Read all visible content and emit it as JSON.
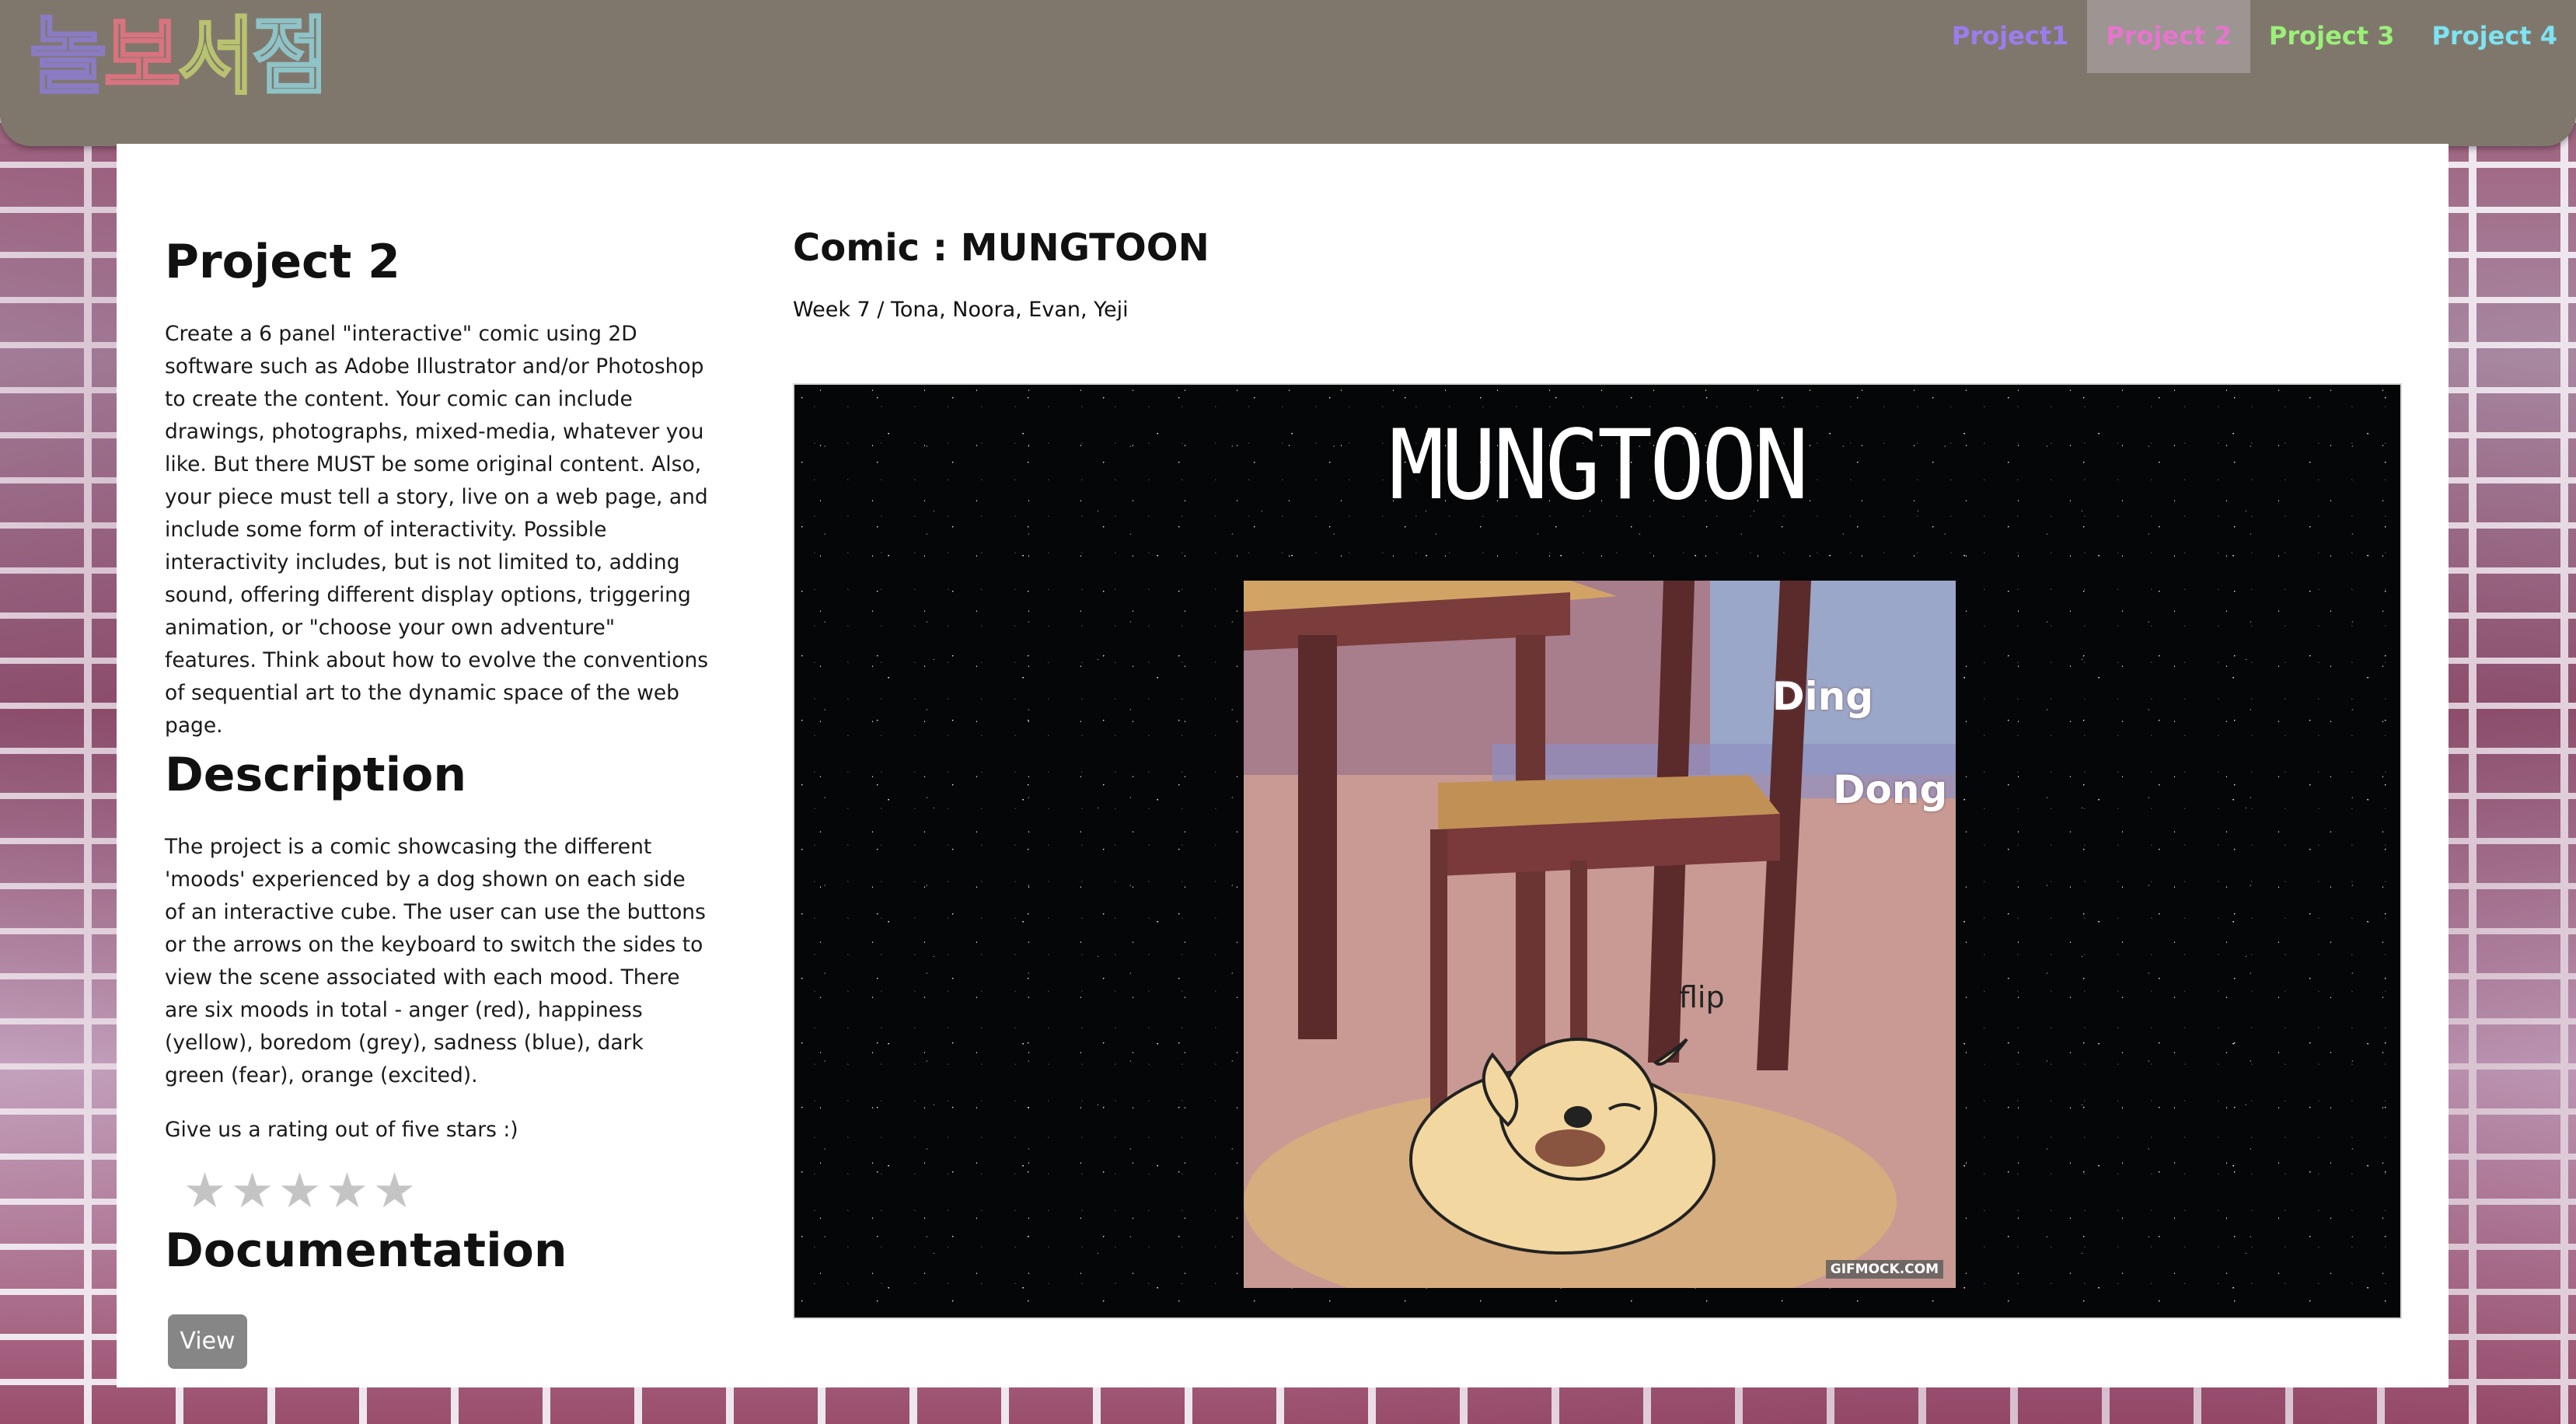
{
  "header": {
    "logo_text": "놀보서점",
    "logo_colors": [
      "#8a7bc4",
      "#d9737f",
      "#b8c270",
      "#8ec3c7"
    ],
    "nav": [
      {
        "label": "Project1",
        "color": "#9b7df0",
        "active": false
      },
      {
        "label": "Project 2",
        "color": "#e774cf",
        "active": true
      },
      {
        "label": "Project 3",
        "color": "#9bf079",
        "active": false
      },
      {
        "label": "Project 4",
        "color": "#7ee3f2",
        "active": false
      }
    ]
  },
  "left": {
    "title": "Project 2",
    "brief": "Create a 6 panel \"interactive\" comic using 2D software such as Adobe Illustrator and/or Photoshop to create the content. Your comic can include drawings, photographs, mixed-media, whatever you like. But there MUST be some original content. Also, your piece must tell a story, live on a web page, and include some form of interactivity. Possible interactivity includes, but is not limited to, adding sound, offering different display options, triggering animation, or \"choose your own adventure\" features. Think about how to evolve the conventions of sequential art to the dynamic space of the web page.",
    "description_heading": "Description",
    "description": "The project is a comic showcasing the different 'moods' experienced by a dog shown on each side of an interactive cube. The user can use the buttons or the arrows on the keyboard to switch the sides to view the scene associated with each mood. There are six moods in total - anger (red), happiness (yellow), boredom (grey), sadness (blue), dark green (fear), orange (excited).",
    "rating_prompt": "Give us a rating out of five stars :)",
    "rating": {
      "value": 0,
      "max": 5,
      "star_glyph": "★"
    },
    "documentation_heading": "Documentation",
    "view_button": "View"
  },
  "right": {
    "comic_title": "Comic : MUNGTOON",
    "credits": "Week 7 / Tona, Noora, Evan, Yeji",
    "comic": {
      "logo": "MUNGTOON",
      "sfx": {
        "ding": "Ding",
        "dong": "Dong",
        "flip": "flip"
      },
      "watermark": "GIFMOCK.COM"
    }
  }
}
